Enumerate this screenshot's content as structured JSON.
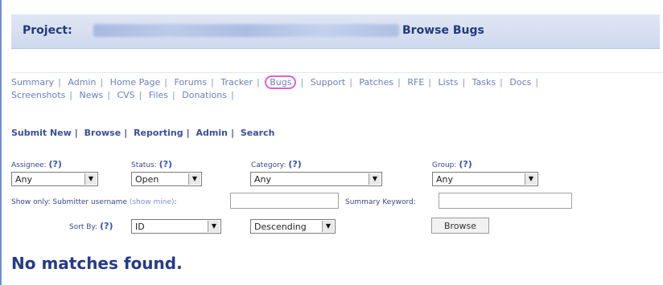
{
  "header": {
    "project_label": "Project:",
    "page_title": "Browse Bugs"
  },
  "nav": {
    "row1": [
      "Summary",
      "Admin",
      "Home Page",
      "Forums",
      "Tracker",
      "Bugs",
      "Support",
      "Patches",
      "RFE",
      "Lists",
      "Tasks",
      "Docs"
    ],
    "row2": [
      "Screenshots",
      "News",
      "CVS",
      "Files",
      "Donations"
    ]
  },
  "subnav": [
    "Submit New",
    "Browse",
    "Reporting",
    "Admin",
    "Search"
  ],
  "filters": {
    "assignee": {
      "label": "Assignee:",
      "help": "(?)",
      "value": "Any"
    },
    "status": {
      "label": "Status:",
      "help": "(?)",
      "value": "Open"
    },
    "category": {
      "label": "Category:",
      "help": "(?)",
      "value": "Any"
    },
    "group": {
      "label": "Group:",
      "help": "(?)",
      "value": "Any"
    },
    "show_only_label": "Show only: Submitter username",
    "show_mine_link": "(show mine)",
    "show_only_colon": ":",
    "summary_keyword_label": "Summary Keyword:",
    "sort_by": {
      "label": "Sort By:",
      "help": "(?)",
      "value": "ID"
    },
    "order": {
      "value": "Descending"
    },
    "browse_button": "Browse"
  },
  "result_message": "No matches found.",
  "colors": {
    "accent": "#243a8a",
    "highlight_circle": "#e25fd3"
  }
}
